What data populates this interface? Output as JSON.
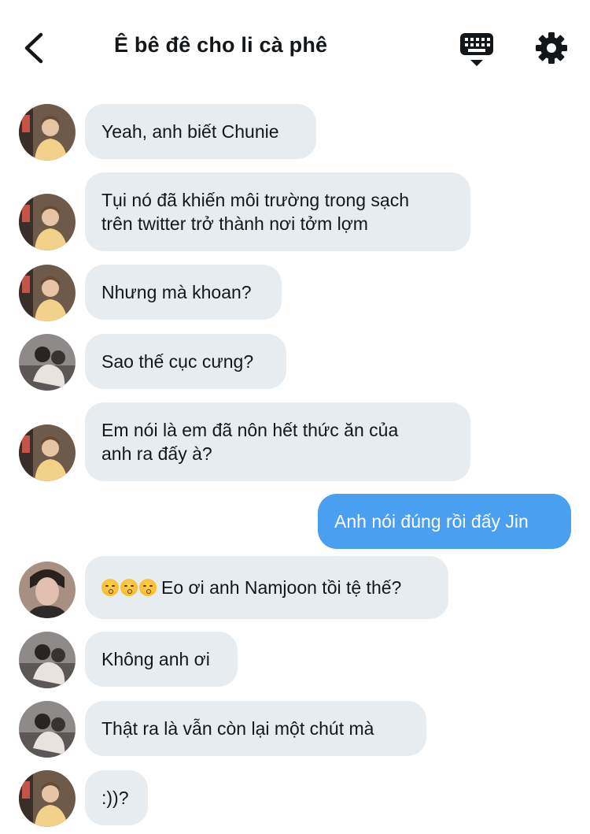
{
  "header": {
    "title": "Ê bê đê cho li cà phê",
    "back_icon": "chevron-left-icon",
    "keyboard_icon": "keyboard-icon",
    "settings_icon": "gear-icon"
  },
  "colors": {
    "incoming_bubble": "#e6ecf0",
    "outgoing_bubble": "#4a9ff0"
  },
  "messages": [
    {
      "sender": "a",
      "text": "Yeah, anh biết Chunie"
    },
    {
      "sender": "a",
      "text": "Tụi nó đã khiến môi trường trong sạch\ntrên twitter trở thành nơi tởm lợm"
    },
    {
      "sender": "a",
      "text": "Nhưng mà khoan?"
    },
    {
      "sender": "b",
      "text": "Sao thế cục cưng?"
    },
    {
      "sender": "a",
      "text": "Em nói là em đã nôn hết thức ăn của\nanh ra đấy à?"
    },
    {
      "sender": "me",
      "text": "Anh nói đúng rồi đấy Jin"
    },
    {
      "sender": "c",
      "emoji": "kissing-face-x3",
      "text": "Eo ơi anh Namjoon tồi tệ thế?"
    },
    {
      "sender": "b",
      "text": "Không anh ơi"
    },
    {
      "sender": "b",
      "text": "Thật ra là vẫn còn lại một chút mà"
    },
    {
      "sender": "a",
      "text": ":))?"
    }
  ]
}
